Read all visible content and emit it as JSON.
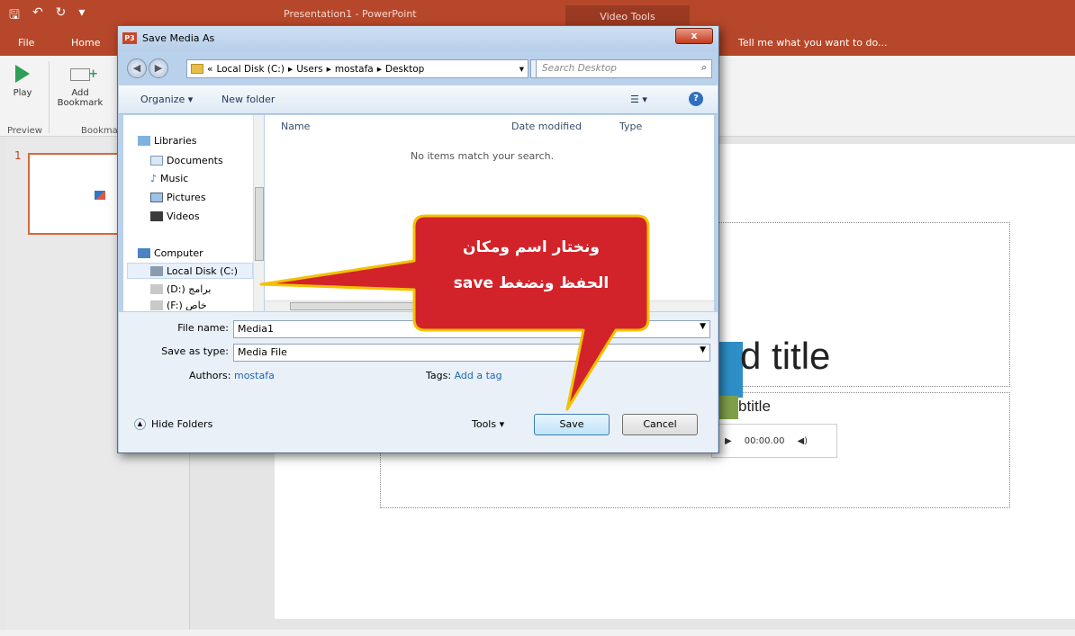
{
  "app": {
    "window_title": "Presentation1 - PowerPoint",
    "context_tab": "Video Tools",
    "tabs": [
      "File",
      "Home"
    ],
    "tell_me": "Tell me what you want to do...",
    "ribbon": {
      "play_label": "Play",
      "add_bookmark_label": "Add Bookmark",
      "preview_group": "Preview",
      "bookmarks_group": "Bookma"
    },
    "slide_number": "1",
    "slide": {
      "title_partial": "d title",
      "subtitle_partial": "btitle",
      "media_time": "00:00.00"
    }
  },
  "dialog": {
    "title": "Save Media As",
    "app_icon": "P3",
    "close": "x",
    "breadcrumb": [
      "«",
      "Local Disk (C:)",
      "Users",
      "mostafa",
      "Desktop"
    ],
    "search_placeholder": "Search Desktop",
    "toolbar": {
      "organize": "Organize ▾",
      "new_folder": "New folder"
    },
    "nav": [
      {
        "label": "Libraries",
        "icon": "libraries-icon"
      },
      {
        "label": "Documents",
        "icon": "documents-icon"
      },
      {
        "label": "Music",
        "icon": "music-icon"
      },
      {
        "label": "Pictures",
        "icon": "pictures-icon"
      },
      {
        "label": "Videos",
        "icon": "videos-icon"
      },
      {
        "label": "Computer",
        "icon": "computer-icon"
      },
      {
        "label": "Local Disk (C:)",
        "icon": "drive-icon"
      },
      {
        "label": "(D:) برامج",
        "icon": "drive-icon"
      },
      {
        "label": "(F:) خاص",
        "icon": "drive-icon"
      }
    ],
    "columns": {
      "name": "Name",
      "date": "Date modified",
      "type": "Type"
    },
    "empty_message": "No items match your search.",
    "file_name_label": "File name:",
    "file_name_value": "Media1",
    "save_type_label": "Save as type:",
    "save_type_value": "Media File",
    "authors_label": "Authors:",
    "authors_value": "mostafa",
    "tags_label": "Tags:",
    "tags_value": "Add a tag",
    "hide_folders": "Hide Folders",
    "tools": "Tools",
    "save_button": "Save",
    "cancel_button": "Cancel"
  },
  "callout": {
    "line1": "ونختار اسم ومكان",
    "line2": "الحفظ ونضغط save",
    "fill": "#d2232a",
    "stroke": "#f2c200"
  }
}
